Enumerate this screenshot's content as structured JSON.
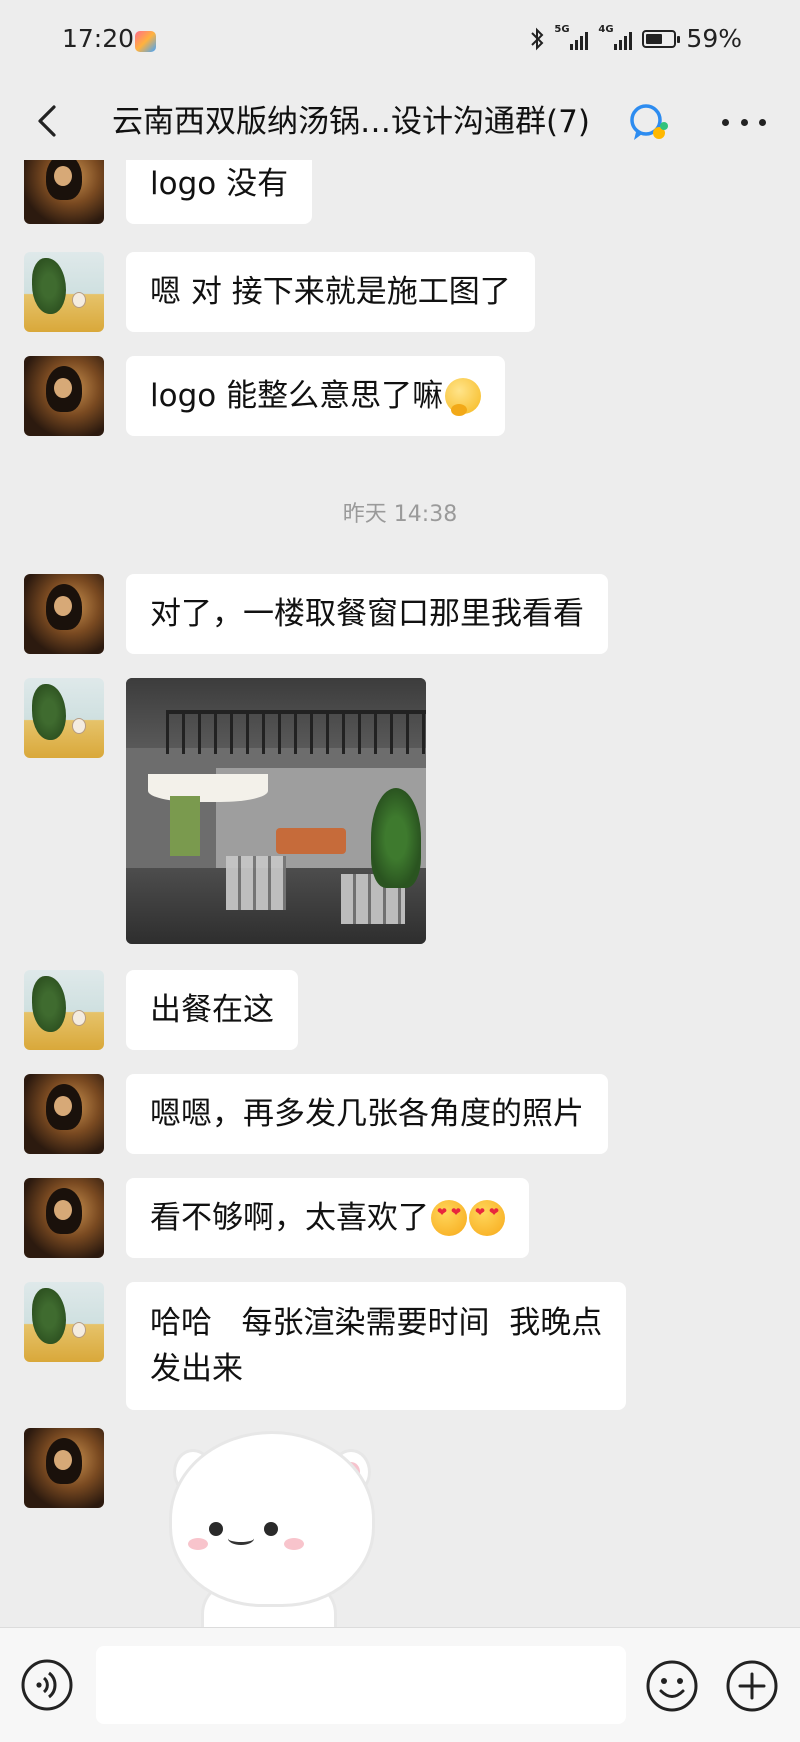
{
  "status_bar": {
    "time": "17:20",
    "network1": "5G",
    "network2": "4G",
    "battery_percent": "59%",
    "battery_level": 0.59
  },
  "header": {
    "title": "云南西双版纳汤锅…设计沟通群(7)"
  },
  "chat": {
    "messages": [
      {
        "sender": "girl",
        "text": "logo 没有"
      },
      {
        "sender": "tree",
        "text": "嗯 对  接下来就是施工图了"
      },
      {
        "sender": "girl",
        "text": "logo 能整么意思了嘛",
        "emoji": "thinking-face"
      },
      {
        "timestamp": "昨天 14:38"
      },
      {
        "sender": "girl",
        "text": "对了，一楼取餐窗口那里我看看"
      },
      {
        "sender": "tree",
        "image": "restaurant-render-photo"
      },
      {
        "sender": "tree",
        "text": "出餐在这"
      },
      {
        "sender": "girl",
        "text": "嗯嗯，再多发几张各角度的照片"
      },
      {
        "sender": "girl",
        "text": "看不够啊，太喜欢了",
        "emoji": "heart-eyes-face x2"
      },
      {
        "sender": "tree",
        "text_line1": "哈哈   每张渲染需要时间  我晚点",
        "text_line2": "发出来"
      },
      {
        "sender": "girl",
        "sticker": "white-cat-sticker"
      }
    ]
  },
  "colors": {
    "background": "#ededed",
    "bubble": "#ffffff",
    "timestamp": "#9a9a9a"
  }
}
